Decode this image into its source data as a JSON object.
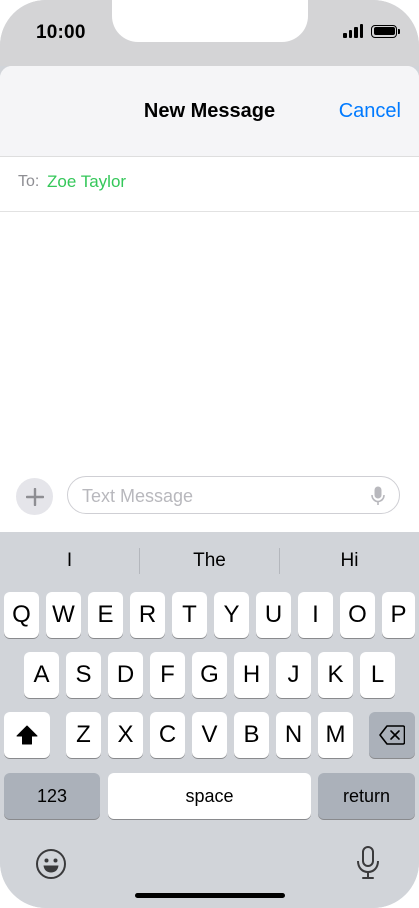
{
  "status_bar": {
    "time": "10:00"
  },
  "nav": {
    "title": "New Message",
    "cancel_label": "Cancel"
  },
  "recipient": {
    "to_label": "To:",
    "name": "Zoe Taylor"
  },
  "composer": {
    "placeholder": "Text Message",
    "plus_icon": "plus-icon",
    "mic_icon": "microphone-icon"
  },
  "keyboard": {
    "suggestions": [
      "I",
      "The",
      "Hi"
    ],
    "row1": [
      "Q",
      "W",
      "E",
      "R",
      "T",
      "Y",
      "U",
      "I",
      "O",
      "P"
    ],
    "row2": [
      "A",
      "S",
      "D",
      "F",
      "G",
      "H",
      "J",
      "K",
      "L"
    ],
    "row3": [
      "Z",
      "X",
      "C",
      "V",
      "B",
      "N",
      "M"
    ],
    "numbers_label": "123",
    "space_label": "space",
    "return_label": "return",
    "shift_icon": "shift-icon",
    "delete_icon": "delete-icon",
    "emoji_icon": "emoji-icon",
    "dictation_icon": "microphone-icon"
  },
  "colors": {
    "accent": "#007aff",
    "recipient": "#34c759"
  }
}
